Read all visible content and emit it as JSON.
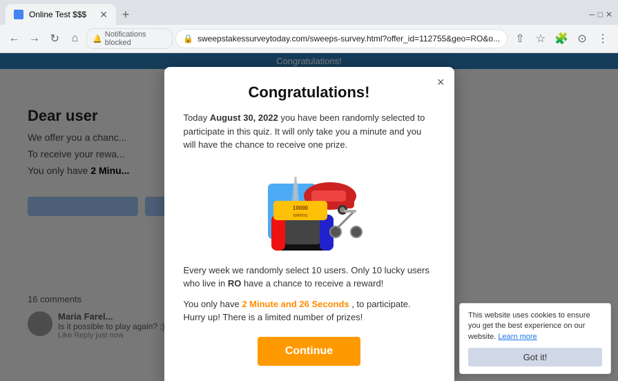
{
  "browser": {
    "tab_title": "Online Test $$$",
    "notifications_label": "Notifications blocked",
    "url": "sweepstakessurveytoday.com/sweeps-survey.html?offer_id=112755&geo=RO&o...",
    "new_tab_label": "+"
  },
  "top_banner": {
    "text": "Congratulations!"
  },
  "background": {
    "title": "Dear user",
    "para1": "We offer you a chanc...",
    "para2": "To receive your rewa...",
    "para3": "You only have",
    "para3_bold": "2 Minu...",
    "comments_label": "16 comments",
    "commenter_name": "Maria Farel...",
    "comment_text": "Is it possible to play again? :)",
    "comment_meta": "Like  Reply  just now"
  },
  "modal": {
    "title": "Congratulations!",
    "close_label": "×",
    "intro": "Today",
    "intro_date": "August 30, 2022",
    "intro_rest": "you have been randomly selected to participate in this quiz. It will only take you a minute and you will have the chance to receive one prize.",
    "body1": "Every week we randomly select 10 users. Only 10 lucky users who live in",
    "body1_bold": "RO",
    "body1_rest": "have a chance to receive a reward!",
    "timer_prefix": "You only have",
    "timer_value": "2 Minute and 26 Seconds",
    "timer_suffix": ", to participate.",
    "hurry": "Hurry up! There is a limited number of prizes!",
    "continue_btn": "Continue"
  },
  "cookie": {
    "text": "This website uses cookies to ensure you get the best experience on our website.",
    "learn_more": "Learn more",
    "got_btn": "Got it!"
  }
}
